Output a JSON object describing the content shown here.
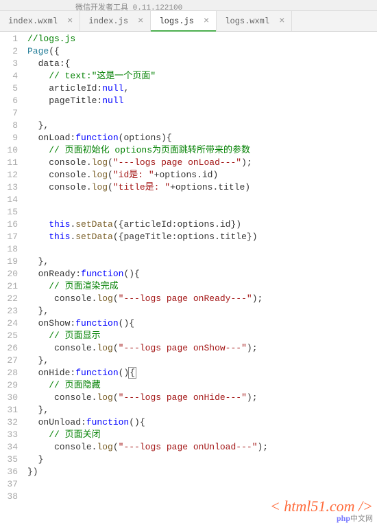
{
  "window_title": "微信开发者工具 0.11.122100",
  "tabs": [
    {
      "label": "index.wxml",
      "active": false
    },
    {
      "label": "index.js",
      "active": false
    },
    {
      "label": "logs.js",
      "active": true
    },
    {
      "label": "logs.wxml",
      "active": false
    }
  ],
  "code": {
    "lines": [
      [
        {
          "t": "//logs.js",
          "c": "comment"
        }
      ],
      [
        {
          "t": "Page",
          "c": "class"
        },
        {
          "t": "({",
          "c": "punc"
        }
      ],
      [
        {
          "t": "  data",
          "c": "prop"
        },
        {
          "t": ":{",
          "c": "punc"
        }
      ],
      [
        {
          "t": "    ",
          "c": "punc"
        },
        {
          "t": "// text:\"这是一个页面\"",
          "c": "comment"
        }
      ],
      [
        {
          "t": "    articleId",
          "c": "prop"
        },
        {
          "t": ":",
          "c": "punc"
        },
        {
          "t": "null",
          "c": "keyword"
        },
        {
          "t": ",",
          "c": "punc"
        }
      ],
      [
        {
          "t": "    pageTitle",
          "c": "prop"
        },
        {
          "t": ":",
          "c": "punc"
        },
        {
          "t": "null",
          "c": "keyword"
        }
      ],
      [
        {
          "t": " ",
          "c": "punc"
        }
      ],
      [
        {
          "t": "  },",
          "c": "punc"
        }
      ],
      [
        {
          "t": "  onLoad",
          "c": "prop"
        },
        {
          "t": ":",
          "c": "punc"
        },
        {
          "t": "function",
          "c": "keyword"
        },
        {
          "t": "(",
          "c": "punc"
        },
        {
          "t": "options",
          "c": "prop"
        },
        {
          "t": "){",
          "c": "punc"
        }
      ],
      [
        {
          "t": "    ",
          "c": "punc"
        },
        {
          "t": "// 页面初始化 options为页面跳转所带来的参数",
          "c": "comment"
        }
      ],
      [
        {
          "t": "    console",
          "c": "prop"
        },
        {
          "t": ".",
          "c": "punc"
        },
        {
          "t": "log",
          "c": "func"
        },
        {
          "t": "(",
          "c": "punc"
        },
        {
          "t": "\"---logs page onLoad---\"",
          "c": "string"
        },
        {
          "t": ");",
          "c": "punc"
        }
      ],
      [
        {
          "t": "    console",
          "c": "prop"
        },
        {
          "t": ".",
          "c": "punc"
        },
        {
          "t": "log",
          "c": "func"
        },
        {
          "t": "(",
          "c": "punc"
        },
        {
          "t": "\"id是: \"",
          "c": "string"
        },
        {
          "t": "+options.id)",
          "c": "punc"
        }
      ],
      [
        {
          "t": "    console",
          "c": "prop"
        },
        {
          "t": ".",
          "c": "punc"
        },
        {
          "t": "log",
          "c": "func"
        },
        {
          "t": "(",
          "c": "punc"
        },
        {
          "t": "\"title是: \"",
          "c": "string"
        },
        {
          "t": "+options.title)",
          "c": "punc"
        }
      ],
      [
        {
          "t": " ",
          "c": "punc"
        }
      ],
      [
        {
          "t": " ",
          "c": "punc"
        }
      ],
      [
        {
          "t": "    ",
          "c": "punc"
        },
        {
          "t": "this",
          "c": "keyword"
        },
        {
          "t": ".",
          "c": "punc"
        },
        {
          "t": "setData",
          "c": "func"
        },
        {
          "t": "({articleId:options.id})",
          "c": "punc"
        }
      ],
      [
        {
          "t": "    ",
          "c": "punc"
        },
        {
          "t": "this",
          "c": "keyword"
        },
        {
          "t": ".",
          "c": "punc"
        },
        {
          "t": "setData",
          "c": "func"
        },
        {
          "t": "({pageTitle:options.title})",
          "c": "punc"
        }
      ],
      [
        {
          "t": " ",
          "c": "punc"
        }
      ],
      [
        {
          "t": "  },",
          "c": "punc"
        }
      ],
      [
        {
          "t": "  onReady",
          "c": "prop"
        },
        {
          "t": ":",
          "c": "punc"
        },
        {
          "t": "function",
          "c": "keyword"
        },
        {
          "t": "(){",
          "c": "punc"
        }
      ],
      [
        {
          "t": "    ",
          "c": "punc"
        },
        {
          "t": "// 页面渲染完成",
          "c": "comment"
        }
      ],
      [
        {
          "t": "     console",
          "c": "prop"
        },
        {
          "t": ".",
          "c": "punc"
        },
        {
          "t": "log",
          "c": "func"
        },
        {
          "t": "(",
          "c": "punc"
        },
        {
          "t": "\"---logs page onReady---\"",
          "c": "string"
        },
        {
          "t": ");",
          "c": "punc"
        }
      ],
      [
        {
          "t": "  },",
          "c": "punc"
        }
      ],
      [
        {
          "t": "  onShow",
          "c": "prop"
        },
        {
          "t": ":",
          "c": "punc"
        },
        {
          "t": "function",
          "c": "keyword"
        },
        {
          "t": "(){",
          "c": "punc"
        }
      ],
      [
        {
          "t": "    ",
          "c": "punc"
        },
        {
          "t": "// 页面显示",
          "c": "comment"
        }
      ],
      [
        {
          "t": "     console",
          "c": "prop"
        },
        {
          "t": ".",
          "c": "punc"
        },
        {
          "t": "log",
          "c": "func"
        },
        {
          "t": "(",
          "c": "punc"
        },
        {
          "t": "\"---logs page onShow---\"",
          "c": "string"
        },
        {
          "t": ");",
          "c": "punc"
        }
      ],
      [
        {
          "t": "  },",
          "c": "punc"
        }
      ],
      [
        {
          "t": "  onHide",
          "c": "prop"
        },
        {
          "t": ":",
          "c": "punc"
        },
        {
          "t": "function",
          "c": "keyword"
        },
        {
          "t": "()",
          "c": "punc"
        },
        {
          "t": "{",
          "c": "punc",
          "cursor": true
        }
      ],
      [
        {
          "t": "    ",
          "c": "punc"
        },
        {
          "t": "// 页面隐藏",
          "c": "comment"
        }
      ],
      [
        {
          "t": "     console",
          "c": "prop"
        },
        {
          "t": ".",
          "c": "punc"
        },
        {
          "t": "log",
          "c": "func"
        },
        {
          "t": "(",
          "c": "punc"
        },
        {
          "t": "\"---logs page onHide---\"",
          "c": "string"
        },
        {
          "t": ");",
          "c": "punc"
        }
      ],
      [
        {
          "t": "  },",
          "c": "punc"
        }
      ],
      [
        {
          "t": "  onUnload",
          "c": "prop"
        },
        {
          "t": ":",
          "c": "punc"
        },
        {
          "t": "function",
          "c": "keyword"
        },
        {
          "t": "(){",
          "c": "punc"
        }
      ],
      [
        {
          "t": "    ",
          "c": "punc"
        },
        {
          "t": "// 页面关闭",
          "c": "comment"
        }
      ],
      [
        {
          "t": "     console",
          "c": "prop"
        },
        {
          "t": ".",
          "c": "punc"
        },
        {
          "t": "log",
          "c": "func"
        },
        {
          "t": "(",
          "c": "punc"
        },
        {
          "t": "\"---logs page onUnload---\"",
          "c": "string"
        },
        {
          "t": ");",
          "c": "punc"
        }
      ],
      [
        {
          "t": "  }",
          "c": "punc"
        }
      ],
      [
        {
          "t": "})",
          "c": "punc"
        }
      ],
      [
        {
          "t": " ",
          "c": "punc"
        }
      ],
      [
        {
          "t": " ",
          "c": "punc"
        }
      ]
    ]
  },
  "watermark": {
    "main": "< html51.com />",
    "php": "php",
    "sub": "中文网"
  }
}
